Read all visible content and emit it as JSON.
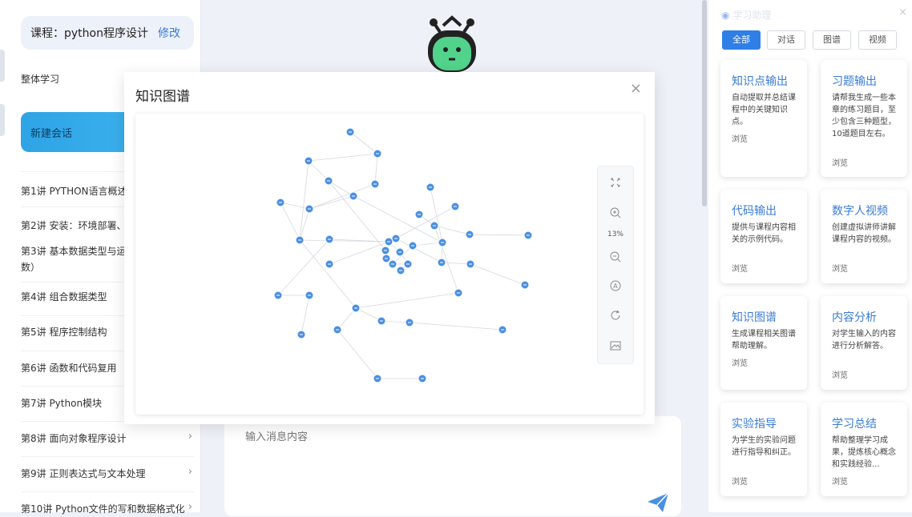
{
  "sidebar": {
    "course_label": "课程：python程序设计",
    "course_edit": "修改",
    "overall_study": "整体学习",
    "new_chat": "新建会话",
    "lessons": [
      {
        "label": "第1讲 PYTHON语言概述"
      },
      {
        "label": "第2讲 安装：环境部署、"
      },
      {
        "label": "第3讲 基本数据类型与运",
        "label2": "数）"
      },
      {
        "label": "第4讲 组合数据类型"
      },
      {
        "label": "第5讲 程序控制结构"
      },
      {
        "label": "第6讲 函数和代码复用"
      },
      {
        "label": "第7讲 Python模块"
      },
      {
        "label": "第8讲 面向对象程序设计"
      },
      {
        "label": "第9讲 正则表达式与文本处理"
      },
      {
        "label": "第10讲 Python文件的写和数据格式化"
      }
    ],
    "chevron": "›"
  },
  "modal": {
    "title": "知识图谱",
    "close": "×",
    "zoom": "13%",
    "node_color": "#4a90e2",
    "edge_color": "#d4d8de"
  },
  "chat": {
    "placeholder": "输入消息内容"
  },
  "right_panel": {
    "header": "学习助理",
    "close": "×",
    "filters": [
      "全部",
      "对话",
      "图谱",
      "视频"
    ],
    "cards": [
      {
        "title": "知识点输出",
        "desc": "自动提取并总结课程中的关键知识点。",
        "browse": "浏览"
      },
      {
        "title": "习题输出",
        "desc": "请帮我生成一些本章的练习题目，至少包含三种题型，10道题目左右。",
        "browse": "浏览"
      },
      {
        "title": "代码输出",
        "desc": "提供与课程内容相关的示例代码。",
        "browse": "浏览"
      },
      {
        "title": "数字人视频",
        "desc": "创建虚拟讲师讲解课程内容的视频。",
        "browse": "浏览"
      },
      {
        "title": "知识图谱",
        "desc": "生成课程相关图谱帮助理解。",
        "browse": "浏览"
      },
      {
        "title": "内容分析",
        "desc": "对学生输入的内容进行分析解答。",
        "browse": "浏览"
      },
      {
        "title": "实验指导",
        "desc": "为学生的实验问题进行指导和纠正。",
        "browse": "浏览"
      },
      {
        "title": "学习总结",
        "desc": "帮助整理学习成果，提炼核心概念和实践经验...",
        "browse": "浏览"
      }
    ]
  }
}
